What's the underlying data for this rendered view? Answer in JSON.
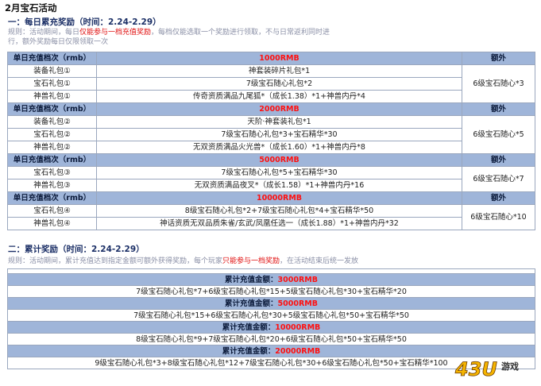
{
  "title": "2月宝石活动",
  "section1": {
    "title": "一：每日累充奖励（时间：2.24-2.29）",
    "rules_a": "规则：活动期间，每日",
    "rules_red": "仅能参与一档充值奖励",
    "rules_b": "，每档仅能选取一个奖励进行领取，不与日常返利同时进",
    "rules_line2": "行，额外奖励每日仅限领取一次"
  },
  "daily_tiers": [
    {
      "header_label": "单日充值档次（rmb）",
      "amount": "1000RMB",
      "extra_header": "额外",
      "rows": [
        {
          "name": "装备礼包①",
          "reward": "神套装碎片礼包*1"
        },
        {
          "name": "宝石礼包①",
          "reward": "7级宝石随心礼包*2"
        },
        {
          "name": "神兽礼包①",
          "reward": "传奇资质满品九尾狐*（成长1.38）*1+神兽内丹*4"
        }
      ],
      "extra": "6级宝石随心*3"
    },
    {
      "header_label": "单日充值档次（rmb）",
      "amount": "2000RMB",
      "extra_header": "额外",
      "rows": [
        {
          "name": "装备礼包②",
          "reward": "天阶·神套装礼包*1"
        },
        {
          "name": "宝石礼包②",
          "reward": "7级宝石随心礼包*3+宝石精华*30"
        },
        {
          "name": "神兽礼包②",
          "reward": "无双资质满品火光兽*（成长1.60）*1+神兽内丹*8"
        }
      ],
      "extra": "6级宝石随心*5"
    },
    {
      "header_label": "单日充值档次（rmb）",
      "amount": "5000RMB",
      "extra_header": "额外",
      "rows": [
        {
          "name": "宝石礼包③",
          "reward": "7级宝石随心礼包*5+宝石精华*30"
        },
        {
          "name": "神兽礼包③",
          "reward": "无双资质满品夜叉*（成长1.58）*1+神兽内丹*16"
        }
      ],
      "extra": "6级宝石随心*7"
    },
    {
      "header_label": "单日充值档次（rmb）",
      "amount": "10000RMB",
      "extra_header": "额外",
      "rows": [
        {
          "name": "宝石礼包④",
          "reward": "8级宝石随心礼包*2+7级宝石随心礼包*4+宝石精华*50"
        },
        {
          "name": "神兽礼包④",
          "reward": "神话资质无双品质朱雀/玄武/凤凰任选一（成长1.88）*1+神兽内丹*32"
        }
      ],
      "extra": "6级宝石随心*10"
    }
  ],
  "section2": {
    "title": "二：累计奖励（时间：2.24-2.29）",
    "rules_a": "规则：活动期间，累计充值达到指定金额可额外获得奖励，每个玩家",
    "rules_red": "只能参与一档奖励",
    "rules_b": "，在活动结束后统一发放"
  },
  "cumulative_tiers": [
    {
      "label": "累计充值金额：",
      "amount": "3000RMB",
      "reward": "7级宝石随心礼包*7+6级宝石随心礼包*15+5级宝石随心礼包*30+宝石精华*20"
    },
    {
      "label": "累计充值金额：",
      "amount": "5000RMB",
      "reward": "7级宝石随心礼包*15+6级宝石随心礼包*30+5级宝石随心礼包*50+宝石精华*50"
    },
    {
      "label": "累计充值金额：",
      "amount": "10000RMB",
      "reward": "8级宝石随心礼包*9+7级宝石随心礼包*20+6级宝石随心礼包*50+宝石精华*50"
    },
    {
      "label": "累计充值金额：",
      "amount": "20000RMB",
      "reward": "9级宝石随心礼包*3+8级宝石随心礼包*12+7级宝石随心礼包*30+6级宝石随心礼包*50+宝石精华*100"
    }
  ],
  "watermark": {
    "brand": "43U",
    "suffix": "游戏"
  }
}
